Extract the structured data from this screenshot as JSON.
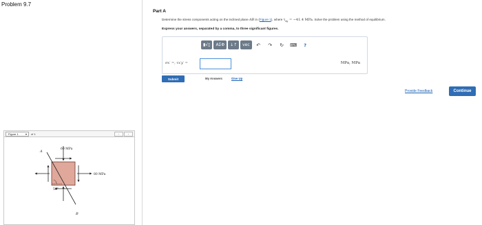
{
  "header": {
    "problem_title": "Problem 9.7"
  },
  "part": {
    "label": "Part A",
    "statement": {
      "before_link": "Determine the stress components acting on the inclined plane ",
      "plane": "AB",
      "in_text": " in (",
      "link": "Figure 1",
      "after_link": "), where ",
      "tau_expr": "τ",
      "tau_sub": "xy",
      "tau_value": " = −41.4 MPa",
      "tail": ". Solve the problem using the method of equilibrium."
    },
    "instruction": "Express your answers, separated by a comma, to three significant figures."
  },
  "toolbar": {
    "buttons": [
      {
        "name": "templates-button",
        "label": "▮√▯"
      },
      {
        "name": "greek-button",
        "label": "ΑΣΦ"
      },
      {
        "name": "vector-ops-button",
        "label": "↓↑"
      },
      {
        "name": "vec-button",
        "label": "vec"
      }
    ],
    "icons": [
      {
        "name": "undo-icon",
        "glyph": "↶"
      },
      {
        "name": "redo-icon",
        "glyph": "↷"
      },
      {
        "name": "reset-icon",
        "glyph": "↻"
      },
      {
        "name": "keyboard-icon",
        "glyph": "⌨"
      },
      {
        "name": "help-icon",
        "glyph": "?"
      }
    ]
  },
  "answer": {
    "label": "σx′ =, τx′y′ =",
    "value": "",
    "units": "MPa, MPa"
  },
  "actions": {
    "submit_label": "Submit",
    "my_answers_label": "My Answers",
    "give_up_label": "Give Up",
    "feedback_label": "Provide Feedback",
    "continue_label": "Continue"
  },
  "figure": {
    "selector_value": "Figure 1",
    "of_label": "of 1",
    "prev_glyph": "‹",
    "next_glyph": "›",
    "top_stress": "60 MPa",
    "right_stress": "80 MPa",
    "point_a": "A",
    "point_b": "B",
    "angle": "50°"
  },
  "colors": {
    "accent": "#2f6db5",
    "link": "#1a5fb4",
    "element_fill": "#dfa89a"
  }
}
